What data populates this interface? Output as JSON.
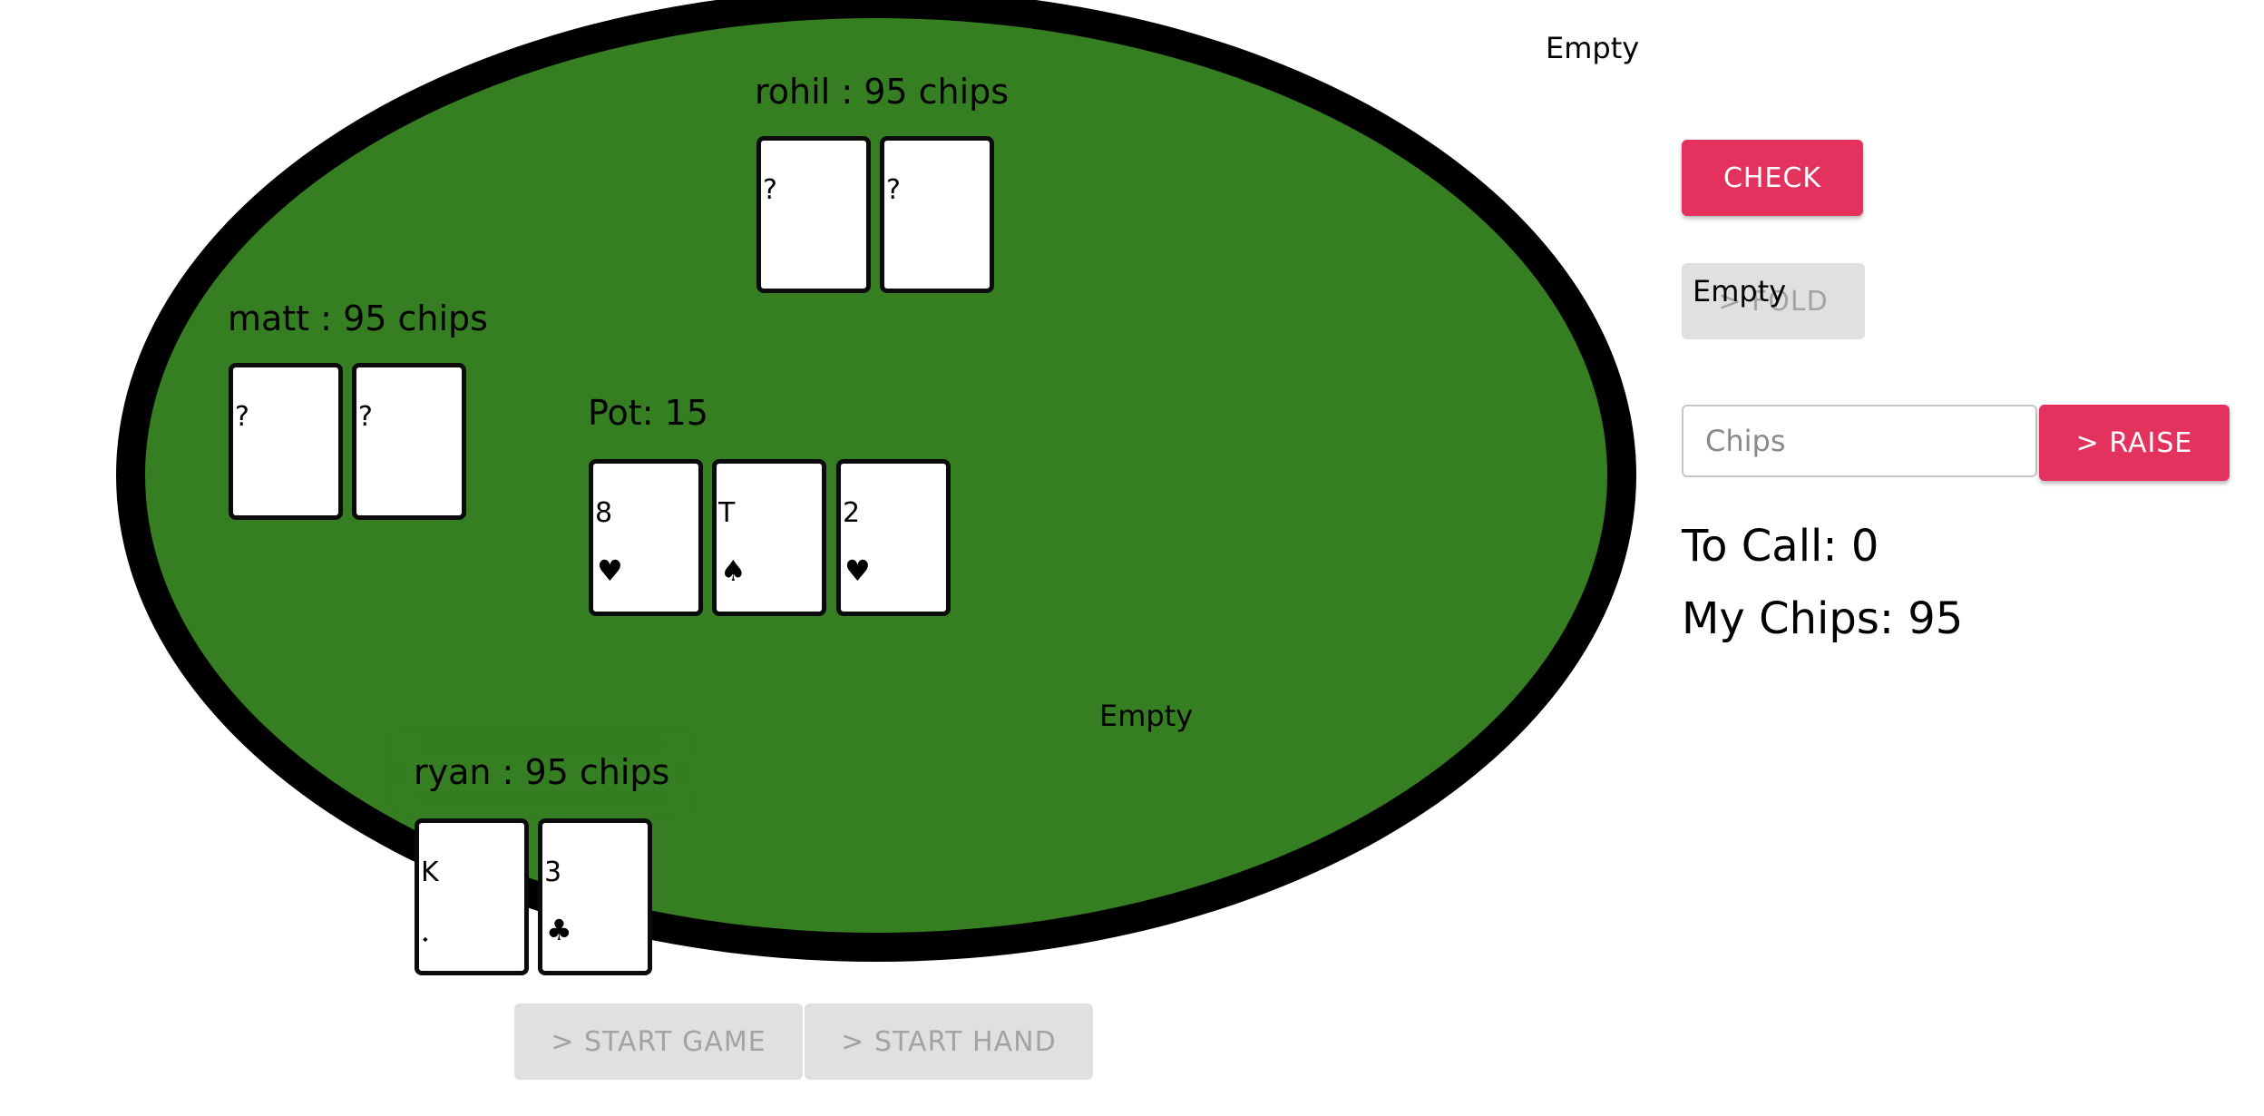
{
  "seats": {
    "top_right_empty": "Empty",
    "fold_overlay_empty": "Empty",
    "table_empty": "Empty"
  },
  "players": {
    "rohil": {
      "label": "rohil : 95 chips",
      "cards": [
        {
          "rank": "?",
          "suit": ""
        },
        {
          "rank": "?",
          "suit": ""
        }
      ]
    },
    "matt": {
      "label": "matt : 95 chips",
      "cards": [
        {
          "rank": "?",
          "suit": ""
        },
        {
          "rank": "?",
          "suit": ""
        }
      ]
    },
    "ryan": {
      "label": "ryan : 95 chips",
      "cards": [
        {
          "rank": "K",
          "suit": "⬩",
          "suit_icon": "diamond-suit-icon"
        },
        {
          "rank": "3",
          "suit": "♣",
          "suit_icon": "club-suit-icon"
        }
      ]
    }
  },
  "pot": {
    "label": "Pot: 15",
    "community_cards": [
      {
        "rank": "8",
        "suit": "♥",
        "suit_icon": "heart-suit-icon"
      },
      {
        "rank": "T",
        "suit": "♠",
        "suit_icon": "spade-suit-icon"
      },
      {
        "rank": "2",
        "suit": "♥",
        "suit_icon": "heart-suit-icon"
      }
    ]
  },
  "controls": {
    "check_label": "CHECK",
    "fold_label": "> FOLD",
    "chips_placeholder": "Chips",
    "chips_value": "",
    "raise_label": "> RAISE",
    "to_call": "To Call: 0",
    "my_chips": "My Chips: 95",
    "start_game_label": "> START GAME",
    "start_hand_label": "> START HAND"
  },
  "colors": {
    "felt": "#367e22",
    "table_border": "#000000",
    "primary_button": "#e3325e",
    "disabled_button": "#e0e0e0",
    "disabled_text": "#a3a3a3"
  }
}
